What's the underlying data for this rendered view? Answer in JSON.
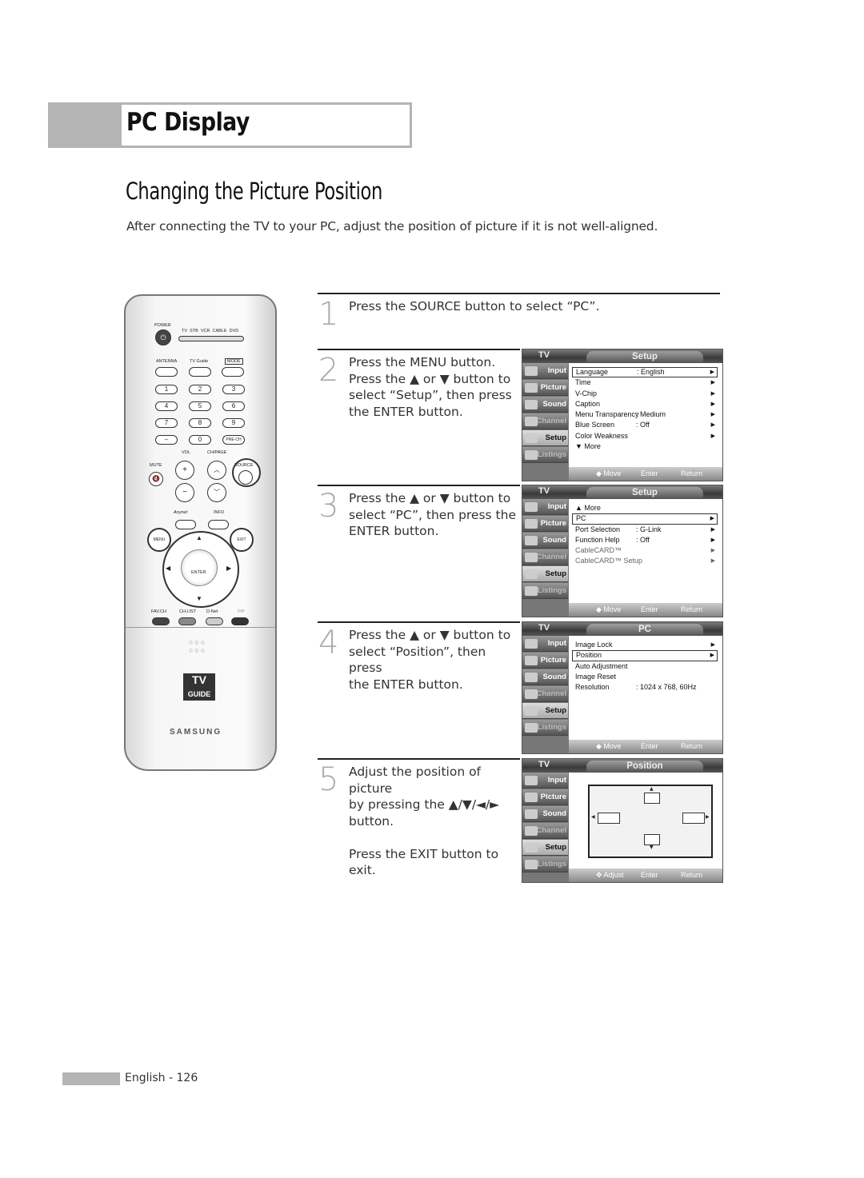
{
  "header": {
    "section_title": "PC Display"
  },
  "page_title": "Changing the Picture Position",
  "intro": "After connecting the TV to your PC, adjust the position of picture if it is not well-aligned.",
  "steps": [
    {
      "num": "1",
      "lines": [
        "Press the SOURCE button to select “PC”."
      ]
    },
    {
      "num": "2",
      "lines": [
        "Press the MENU button.",
        "Press the ▲ or ▼ button to",
        "select “Setup”, then press",
        "the ENTER button."
      ]
    },
    {
      "num": "3",
      "lines": [
        "Press the ▲ or ▼ button to",
        "select “PC”, then press the",
        "ENTER button."
      ]
    },
    {
      "num": "4",
      "lines": [
        "Press the ▲ or ▼ button to",
        "select “Position”, then press",
        "the ENTER button."
      ]
    },
    {
      "num": "5",
      "lines": [
        "Adjust the position of picture",
        "by pressing the ▲/▼/◄/►",
        "button.",
        "",
        "Press the EXIT button to exit."
      ]
    }
  ],
  "sidebar": [
    "Input",
    "Picture",
    "Sound",
    "Channel",
    "Setup",
    "Listings"
  ],
  "screens": [
    {
      "tv": "TV",
      "title": "Setup",
      "rows": [
        {
          "label": "Language",
          "value": ": English",
          "arrow": true,
          "selected": true
        },
        {
          "label": "Time",
          "arrow": true
        },
        {
          "label": "V-Chip",
          "arrow": true
        },
        {
          "label": "Caption",
          "arrow": true
        },
        {
          "label": "Menu Transparency",
          "value": ": Medium",
          "arrow": true
        },
        {
          "label": "Blue Screen",
          "value": ": Off",
          "arrow": true
        },
        {
          "label": "Color Weakness",
          "arrow": true
        },
        {
          "label": "▼ More"
        }
      ],
      "hints": [
        "◆ Move",
        "Enter",
        "Return"
      ]
    },
    {
      "tv": "TV",
      "title": "Setup",
      "rows": [
        {
          "label": "▲ More"
        },
        {
          "label": "PC",
          "arrow": true,
          "selected": true
        },
        {
          "label": "Port Selection",
          "value": ": G-Link",
          "arrow": true
        },
        {
          "label": "Function Help",
          "value": ": Off",
          "arrow": true
        },
        {
          "label": "CableCARD™",
          "arrow": true,
          "dim": true
        },
        {
          "label": "CableCARD™ Setup",
          "arrow": true,
          "dim": true
        }
      ],
      "hints": [
        "◆ Move",
        "Enter",
        "Return"
      ]
    },
    {
      "tv": "TV",
      "title": "PC",
      "rows": [
        {
          "label": "Image Lock",
          "arrow": true
        },
        {
          "label": "Position",
          "arrow": true,
          "selected": true
        },
        {
          "label": "Auto Adjustment"
        },
        {
          "label": "Image Reset"
        },
        {
          "label": "Resolution",
          "value": ": 1024 x 768, 60Hz"
        }
      ],
      "hints": [
        "◆ Move",
        "Enter",
        "Return"
      ]
    },
    {
      "tv": "TV",
      "title": "Position",
      "rows": [],
      "position_diagram": true,
      "hints": [
        "✥ Adjust",
        "Enter",
        "Return"
      ]
    }
  ],
  "remote": {
    "power": "POWER",
    "modes": [
      "TV",
      "STB",
      "VCR",
      "CABLE",
      "DVD"
    ],
    "top_buttons": [
      "ANTENNA",
      "TV Guide",
      "MODE"
    ],
    "keys": [
      "1",
      "2",
      "3",
      "4",
      "5",
      "6",
      "7",
      "8",
      "9",
      "–",
      "0",
      "PRE-CH"
    ],
    "vol": "VOL",
    "ch": "CH/PAGE",
    "mute": "MUTE",
    "source": "SOURCE",
    "anynet": "Anynet",
    "info": "INFO",
    "menu": "MENU",
    "exit": "EXIT",
    "enter": "ENTER",
    "bottom": [
      "FAV.CH",
      "CH.LIST",
      "D-Net",
      "PIP"
    ],
    "logo": "TV GUIDE",
    "brand": "SAMSUNG"
  },
  "footer": "English - 126"
}
